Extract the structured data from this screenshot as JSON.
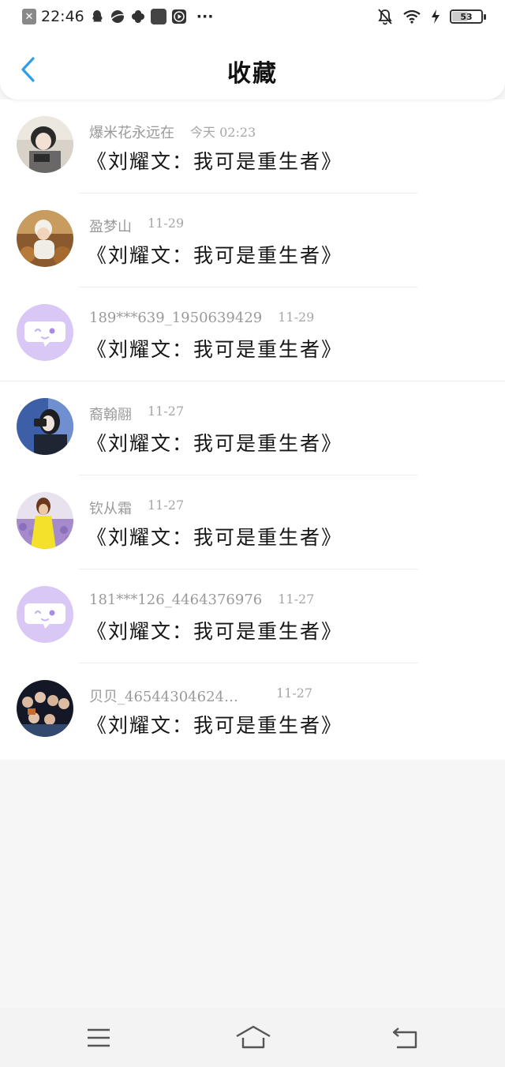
{
  "status_bar": {
    "time": "22:46",
    "more": "···",
    "battery": "53"
  },
  "header": {
    "title": "收藏"
  },
  "items": [
    {
      "name": "爆米花永远在",
      "time": "今天 02:23",
      "title": "《刘耀文：我可是重生者》",
      "avatar": "photo-girl-laptop"
    },
    {
      "name": "盈梦山",
      "time": "11-29",
      "title": "《刘耀文：我可是重生者》",
      "avatar": "photo-baby-leaves"
    },
    {
      "name": "189***639_1950639429",
      "time": "11-29",
      "title": "《刘耀文：我可是重生者》",
      "avatar": "default-chat-bubble"
    },
    {
      "name": "裔翰翮",
      "time": "11-27",
      "title": "《刘耀文：我可是重生者》",
      "avatar": "photo-camera-girl"
    },
    {
      "name": "钦从霜",
      "time": "11-27",
      "title": "《刘耀文：我可是重生者》",
      "avatar": "photo-lavender-field"
    },
    {
      "name": "181***126_4464376976",
      "time": "11-27",
      "title": "《刘耀文：我可是重生者》",
      "avatar": "default-chat-bubble"
    },
    {
      "name": "贝贝_46544304624…",
      "time": "11-27",
      "title": "《刘耀文：我可是重生者》",
      "avatar": "photo-group"
    }
  ],
  "colors": {
    "accent": "#2e9ee6",
    "default_avatar_bg": "#d9c8f5"
  }
}
